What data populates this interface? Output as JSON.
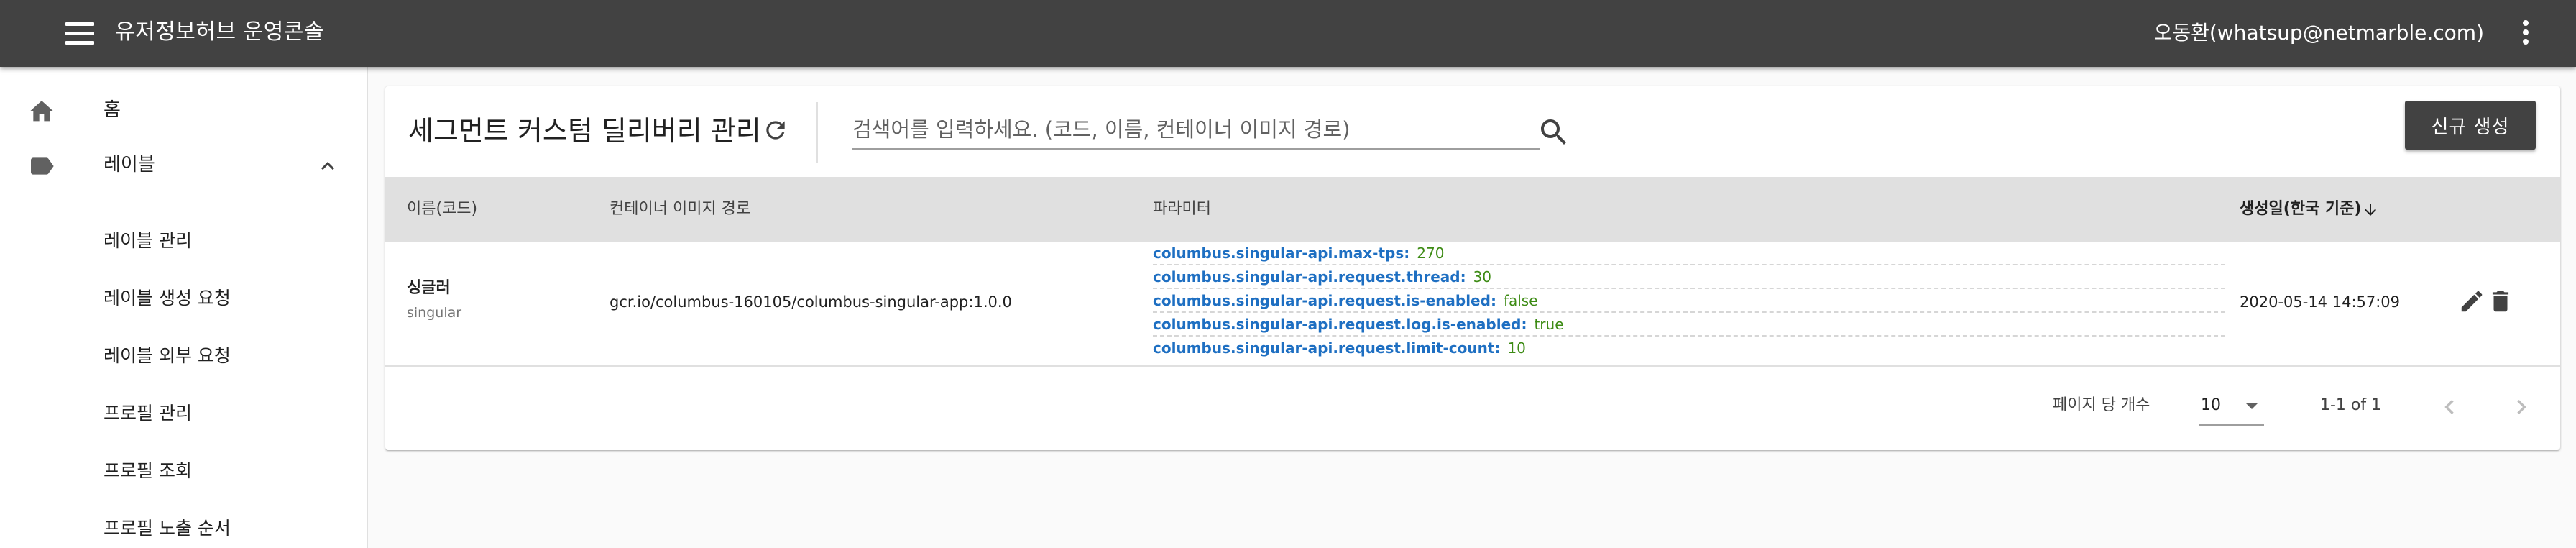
{
  "appbar": {
    "title": "유저정보허브 운영콘솔",
    "user": "오동환(whatsup@netmarble.com)"
  },
  "sidebar": {
    "home_label": "홈",
    "label_group": "레이블",
    "sub_items": [
      "레이블 관리",
      "레이블 생성 요청",
      "레이블 외부 요청",
      "프로필 관리",
      "프로필 조회",
      "프로필 노출 순서"
    ]
  },
  "page": {
    "title": "세그먼트 커스텀 딜리버리 관리",
    "search_placeholder": "검색어를 입력하세요. (코드, 이름, 컨테이너 이미지 경로)",
    "new_button": "신규 생성"
  },
  "table": {
    "headers": {
      "name": "이름(코드)",
      "image": "컨테이너 이미지 경로",
      "params": "파라미터",
      "created": "생성일(한국 기준)"
    },
    "rows": [
      {
        "name": "싱글러",
        "code": "singular",
        "image": "gcr.io/columbus-160105/columbus-singular-app:1.0.0",
        "params": [
          {
            "key": "columbus.singular-api.max-tps:",
            "value": "270"
          },
          {
            "key": "columbus.singular-api.request.thread:",
            "value": "30"
          },
          {
            "key": "columbus.singular-api.request.is-enabled:",
            "value": "false"
          },
          {
            "key": "columbus.singular-api.request.log.is-enabled:",
            "value": "true"
          },
          {
            "key": "columbus.singular-api.request.limit-count:",
            "value": "10"
          }
        ],
        "created": "2020-05-14 14:57:09"
      }
    ]
  },
  "pagination": {
    "per_page_label": "페이지 당 개수",
    "per_page_value": "10",
    "range": "1-1 of 1"
  },
  "colors": {
    "appbar": "#424242",
    "param_key": "#1e6fc2",
    "param_value": "#3d8b14"
  }
}
